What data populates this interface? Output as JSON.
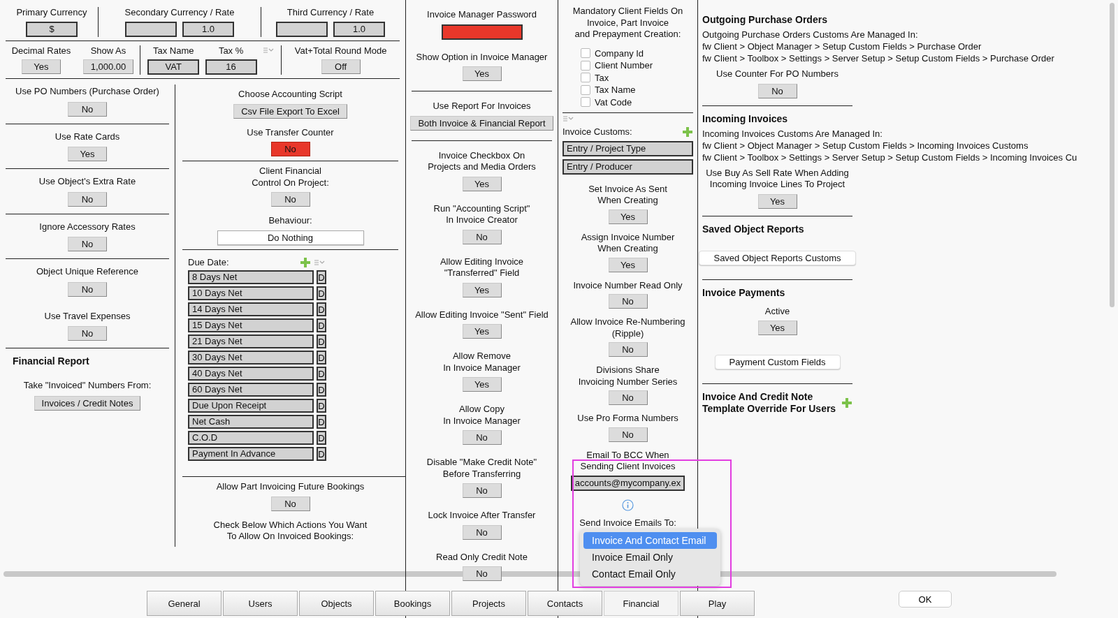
{
  "header_rows": [
    {
      "groups": [
        {
          "settings": [
            {
              "kind": "setting",
              "label": "Primary Currency",
              "controls": [
                {
                  "kind": "field",
                  "value": "$"
                }
              ]
            }
          ]
        },
        {
          "settings": [
            {
              "kind": "setting",
              "label": "Secondary Currency / Rate",
              "controls": [
                {
                  "kind": "field"
                },
                {
                  "kind": "field",
                  "value": "1.0"
                }
              ]
            }
          ]
        },
        {
          "settings": [
            {
              "kind": "setting",
              "label": "Third Currency / Rate",
              "controls": [
                {
                  "kind": "field"
                },
                {
                  "kind": "field",
                  "value": "1.0"
                }
              ]
            }
          ]
        }
      ]
    },
    {
      "groups": [
        {
          "settings": [
            {
              "kind": "setting",
              "label": "Decimal Rates",
              "controls": [
                {
                  "kind": "button",
                  "value": "Yes"
                }
              ]
            },
            {
              "kind": "setting",
              "label": "Show As",
              "controls": [
                {
                  "kind": "button",
                  "value": "1,000.00"
                }
              ]
            }
          ]
        },
        {
          "settings": [
            {
              "kind": "setting",
              "label": "Tax Name",
              "controls": [
                {
                  "kind": "field",
                  "value": "VAT"
                }
              ]
            },
            {
              "kind": "setting",
              "label": "Tax %",
              "controls": [
                {
                  "kind": "field",
                  "value": "16"
                }
              ]
            },
            {
              "kind": "sort"
            }
          ]
        },
        {
          "settings": [
            {
              "kind": "setting",
              "label": "Vat+Total Round Mode",
              "controls": [
                {
                  "kind": "button",
                  "value": "Off"
                }
              ]
            }
          ]
        }
      ]
    }
  ],
  "columns": [
    {
      "blocks": [
        {
          "kind": "setting",
          "label": "Use PO Numbers (Purchase Order)",
          "controls": [
            {
              "kind": "button",
              "value": "No"
            }
          ],
          "rule": true
        },
        {
          "kind": "setting",
          "label": "Use Rate Cards",
          "controls": [
            {
              "kind": "button",
              "value": "Yes"
            }
          ],
          "rule": true
        },
        {
          "kind": "setting",
          "label": "Use Object's Extra Rate",
          "controls": [
            {
              "kind": "button",
              "value": "No"
            }
          ],
          "rule": true
        },
        {
          "kind": "setting",
          "label": "Ignore Accessory Rates",
          "controls": [
            {
              "kind": "button",
              "value": "No"
            }
          ],
          "rule": true
        },
        {
          "kind": "setting",
          "label": "Object Unique Reference",
          "controls": [
            {
              "kind": "button",
              "value": "No"
            }
          ]
        },
        {
          "kind": "setting",
          "label": "Use Travel Expenses",
          "controls": [
            {
              "kind": "button",
              "value": "No"
            }
          ],
          "rule": true
        },
        {
          "kind": "heading",
          "text": "Financial Report"
        },
        {
          "kind": "setting",
          "label": "Take \"Invoiced\" Numbers From:",
          "controls": [
            {
              "kind": "button",
              "value": "Invoices / Credit Notes"
            }
          ]
        }
      ]
    },
    {
      "blocks": [
        {
          "kind": "setting",
          "label": "Choose Accounting Script",
          "controls": [
            {
              "kind": "button",
              "value": "Csv File Export To Excel"
            }
          ]
        },
        {
          "kind": "setting",
          "label": "Use Transfer Counter",
          "controls": [
            {
              "kind": "alert",
              "value": "No"
            }
          ],
          "rule": true
        },
        {
          "kind": "setting",
          "label": "Client Financial\nControl On Project:",
          "controls": [
            {
              "kind": "button",
              "value": "No"
            }
          ]
        },
        {
          "kind": "setting",
          "label": "Behaviour:",
          "controls": [
            {
              "kind": "plain",
              "value": "Do Nothing"
            }
          ],
          "rule": true
        },
        {
          "kind": "sortable_list",
          "label": "Due Date:",
          "rule": true,
          "rows": [
            {
              "value": "8 Days Net",
              "button": "D"
            },
            {
              "value": "10 Days Net",
              "button": "D"
            },
            {
              "value": "14 Days Net",
              "button": "D"
            },
            {
              "value": "15 Days Net",
              "button": "D"
            },
            {
              "value": "21 Days Net",
              "button": "D"
            },
            {
              "value": "30 Days Net",
              "button": "D"
            },
            {
              "value": "40 Days Net",
              "button": "D"
            },
            {
              "value": "60 Days Net",
              "button": "D"
            },
            {
              "value": "Due Upon Receipt",
              "button": "D"
            },
            {
              "value": "Net Cash",
              "button": "D"
            },
            {
              "value": "C.O.D",
              "button": "D"
            },
            {
              "value": "Payment In Advance",
              "button": "D"
            }
          ]
        },
        {
          "kind": "setting",
          "label": "Allow Part Invoicing Future Bookings",
          "controls": [
            {
              "kind": "button",
              "value": "No"
            }
          ]
        },
        {
          "kind": "setting",
          "label": "Check Below Which Actions You Want\nTo Allow On Invoiced Bookings:"
        }
      ]
    },
    {
      "blocks": [
        {
          "kind": "setting",
          "label": "Invoice Manager Password",
          "controls": [
            {
              "kind": "secret"
            }
          ]
        },
        {
          "kind": "setting",
          "label": "Show Option in Invoice Manager",
          "controls": [
            {
              "kind": "button",
              "value": "Yes"
            }
          ],
          "rule": true
        },
        {
          "kind": "setting",
          "label": "Use Report For Invoices",
          "controls": [
            {
              "kind": "button",
              "value": "Both Invoice & Financial Report"
            }
          ],
          "rule": true
        },
        {
          "kind": "setting",
          "label": "Invoice Checkbox On\nProjects and Media Orders",
          "controls": [
            {
              "kind": "button",
              "value": "Yes"
            }
          ]
        },
        {
          "kind": "setting",
          "label": "Run \"Accounting Script\"\nIn Invoice Creator",
          "controls": [
            {
              "kind": "button",
              "value": "No"
            }
          ]
        },
        {
          "kind": "setting",
          "label": "Allow Editing Invoice\n\"Transferred\" Field",
          "controls": [
            {
              "kind": "button",
              "value": "Yes"
            }
          ]
        },
        {
          "kind": "setting",
          "label": "Allow Editing Invoice \"Sent\" Field",
          "controls": [
            {
              "kind": "button",
              "value": "Yes"
            }
          ]
        },
        {
          "kind": "setting",
          "label": "Allow Remove\nIn Invoice Manager",
          "controls": [
            {
              "kind": "button",
              "value": "Yes"
            }
          ]
        },
        {
          "kind": "setting",
          "label": "Allow Copy\nIn Invoice Manager",
          "controls": [
            {
              "kind": "button",
              "value": "No"
            }
          ]
        },
        {
          "kind": "setting",
          "label": "Disable \"Make Credit Note\"\nBefore Transferring",
          "controls": [
            {
              "kind": "button",
              "value": "No"
            }
          ]
        },
        {
          "kind": "setting",
          "label": "Lock Invoice After Transfer",
          "controls": [
            {
              "kind": "button",
              "value": "No"
            }
          ]
        },
        {
          "kind": "setting",
          "label": "Read Only Credit Note",
          "controls": [
            {
              "kind": "button",
              "value": "No"
            }
          ]
        }
      ]
    },
    {
      "blocks": [
        {
          "kind": "setting",
          "label": "Mandatory Client Fields On\nInvoice, Part Invoice\nand Prepayment Creation:"
        },
        {
          "kind": "checks",
          "rule": true,
          "items": [
            {
              "label": "Company Id",
              "checked": false
            },
            {
              "label": "Client Number",
              "checked": false
            },
            {
              "label": "Tax",
              "checked": false
            },
            {
              "label": "Tax Name",
              "checked": false
            },
            {
              "label": "Vat Code",
              "checked": false
            }
          ]
        },
        {
          "kind": "sort"
        },
        {
          "kind": "list",
          "label": "Invoice Customs:",
          "rows": [
            {
              "value": "Entry / Project Type"
            },
            {
              "value": "Entry / Producer"
            }
          ]
        },
        {
          "kind": "setting",
          "label": "Set Invoice As Sent\nWhen Creating",
          "controls": [
            {
              "kind": "button",
              "value": "Yes"
            }
          ]
        },
        {
          "kind": "setting",
          "label": "Assign Invoice Number\nWhen Creating",
          "controls": [
            {
              "kind": "button",
              "value": "Yes"
            }
          ]
        },
        {
          "kind": "setting",
          "label": "Invoice Number Read Only",
          "controls": [
            {
              "kind": "button",
              "value": "No"
            }
          ]
        },
        {
          "kind": "setting",
          "label": "Allow Invoice Re-Numbering\n(Ripple)",
          "controls": [
            {
              "kind": "button",
              "value": "No"
            }
          ]
        },
        {
          "kind": "setting",
          "label": "Divisions Share\nInvoicing Number Series",
          "controls": [
            {
              "kind": "button",
              "value": "No"
            }
          ]
        },
        {
          "kind": "setting",
          "label": "Use Pro Forma Numbers",
          "controls": [
            {
              "kind": "button",
              "value": "No"
            }
          ]
        },
        {
          "kind": "setting",
          "label": "Email To BCC When\nSending Client Invoices",
          "controls": [
            {
              "kind": "field",
              "value": "accounts@mycompany.ex"
            }
          ]
        },
        {
          "kind": "info"
        },
        {
          "kind": "setting",
          "label": "Send Invoice Emails To:"
        }
      ]
    },
    {
      "blocks": [
        {
          "kind": "heading",
          "text": "Outgoing Purchase Orders"
        },
        {
          "kind": "note",
          "lines": [
            "Outgoing Purchase Orders Customs Are Managed In:",
            "fw Client > Object Manager > Setup Custom Fields > Purchase Order",
            "fw Client > Toolbox > Settings > Server Setup > Setup Custom Fields > Purchase Order"
          ]
        },
        {
          "kind": "setting",
          "label": "Use Counter For PO Numbers",
          "controls": [
            {
              "kind": "button",
              "value": "No"
            }
          ],
          "rule": true
        },
        {
          "kind": "heading",
          "text": "Incoming Invoices"
        },
        {
          "kind": "note",
          "lines": [
            "Incoming Invoices Customs Are Managed In:",
            "fw Client > Object Manager > Setup Custom Fields > Incoming Invoices Customs",
            "fw Client > Toolbox > Settings > Server Setup > Setup Custom Fields > Incoming Invoices Cu"
          ]
        },
        {
          "kind": "setting",
          "label": "Use Buy As Sell Rate When Adding\nIncoming Invoice Lines To Project",
          "controls": [
            {
              "kind": "button",
              "value": "Yes"
            }
          ],
          "rule": true
        },
        {
          "kind": "heading",
          "text": "Saved Object Reports"
        },
        {
          "kind": "setting",
          "controls": [
            {
              "kind": "plain",
              "value": "Saved Object Reports Customs"
            }
          ],
          "rule": true
        },
        {
          "kind": "heading",
          "text": "Invoice Payments"
        },
        {
          "kind": "setting",
          "label": "Active",
          "controls": [
            {
              "kind": "button",
              "value": "Yes"
            }
          ]
        },
        {
          "kind": "setting",
          "controls": [
            {
              "kind": "plain",
              "value": "Payment Custom Fields"
            }
          ],
          "rule": true
        },
        {
          "kind": "add_heading",
          "text": "Invoice And Credit Note\nTemplate Override For Users"
        }
      ]
    }
  ],
  "popup": {
    "options": [
      {
        "label": "Invoice And Contact Email",
        "selected": true
      },
      {
        "label": "Invoice Email Only",
        "selected": false
      },
      {
        "label": "Contact Email Only",
        "selected": false
      }
    ]
  },
  "tabs": [
    {
      "label": "General",
      "selected": false
    },
    {
      "label": "Users",
      "selected": false
    },
    {
      "label": "Objects",
      "selected": false
    },
    {
      "label": "Bookings",
      "selected": false
    },
    {
      "label": "Projects",
      "selected": false
    },
    {
      "label": "Contacts",
      "selected": false
    },
    {
      "label": "Financial",
      "selected": true
    },
    {
      "label": "Play",
      "selected": false
    }
  ],
  "ok_button": "OK"
}
